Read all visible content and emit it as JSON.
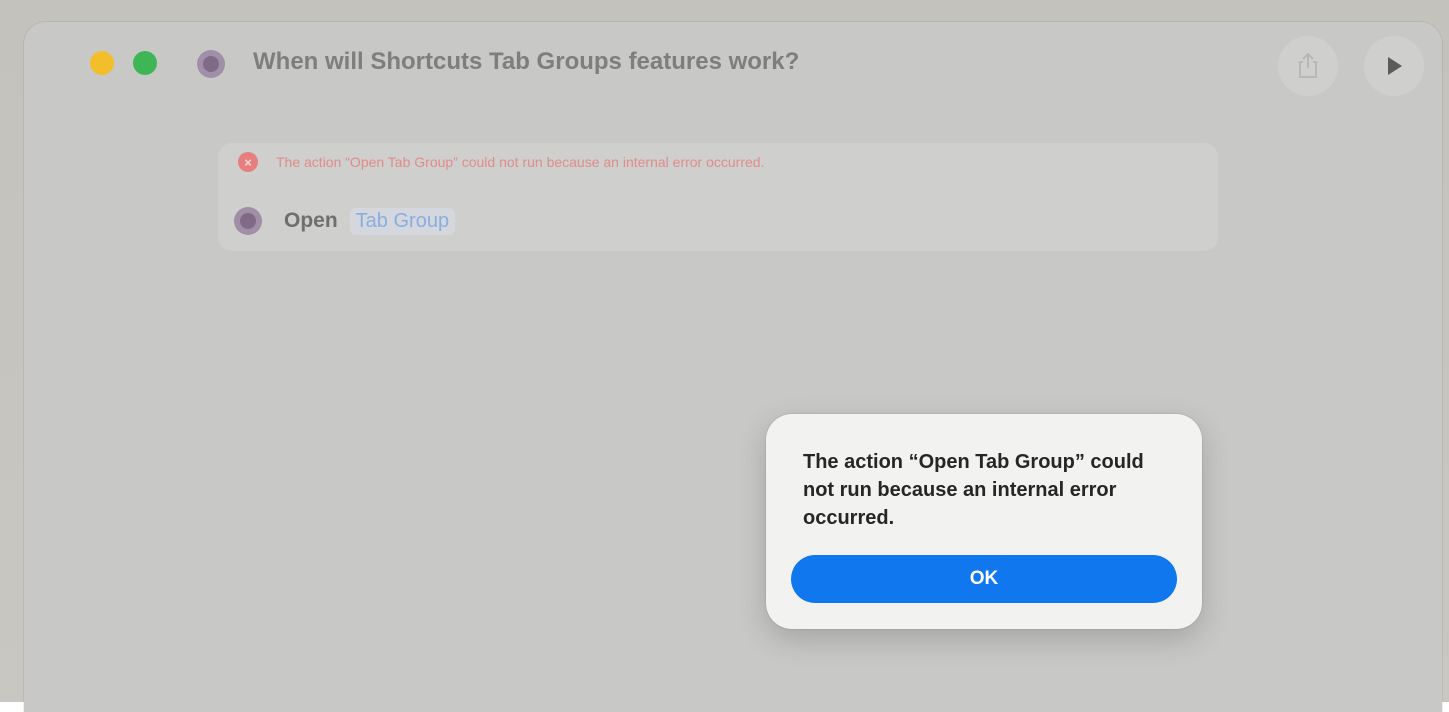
{
  "window": {
    "title": "When will Shortcuts Tab Groups features work?"
  },
  "toolbar": {
    "share_icon": "share-icon",
    "run_icon": "play-icon"
  },
  "action_card": {
    "error_text": "The action “Open Tab Group” could not run because an internal error occurred.",
    "step_verb": "Open",
    "step_parameter": "Tab Group"
  },
  "dialog": {
    "message": "The action “Open Tab Group” could not run because an internal error occurred.",
    "ok_label": "OK"
  },
  "colors": {
    "accent": "#1177ee",
    "error": "#e77f7f",
    "traffic_yellow": "#f3be2c",
    "traffic_green": "#3fb655"
  }
}
